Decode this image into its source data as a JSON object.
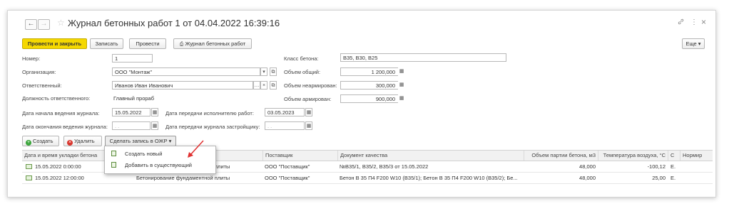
{
  "window": {
    "title": "Журнал бетонных работ 1 от 04.04.2022 16:39:16",
    "back_glyph": "←",
    "forward_glyph": "→",
    "link_glyph": "🔗",
    "menu_glyph": "⋮",
    "close_glyph": "×"
  },
  "toolbar": {
    "post_close": "Провести и закрыть",
    "save": "Записать",
    "post": "Провести",
    "journal": "Журнал бетонных работ",
    "more": "Еще ▾"
  },
  "form": {
    "number_label": "Номер:",
    "number_value": "1",
    "org_label": "Организация:",
    "org_value": "ООО \"Монтаж\"",
    "resp_label": "Ответственный:",
    "resp_value": "Иванов Иван Иванович",
    "position_label": "Должность ответственного:",
    "position_value": "Главный прораб",
    "start_label": "Дата начала ведения журнала:",
    "start_value": "15.05.2022",
    "end_label": "Дата окончания ведения журнала:",
    "end_value": ". .",
    "exec_label": "Дата передачи исполнителю работ:",
    "exec_value": "03.05.2023",
    "dev_label": "Дата передачи журнала застройщику:",
    "dev_value": ". .",
    "class_label": "Класс бетона:",
    "class_value": "В35, В30, В25",
    "vol_total_label": "Объем общий:",
    "vol_total_value": "1 200,000",
    "vol_unreinf_label": "Объем неармирован:",
    "vol_unreinf_value": "300,000",
    "vol_reinf_label": "Объем армирован:",
    "vol_reinf_value": "900,000"
  },
  "table_toolbar": {
    "create": "Создать",
    "delete": "Удалить",
    "make_record": "Сделать запись в ОЖР"
  },
  "dropdown": {
    "items": [
      "Создать новый",
      "Добавить в существующий"
    ]
  },
  "table": {
    "headers": [
      "Дата и время укладки бетона",
      "Поставщик",
      "Документ качества",
      "Объем партии бетона, м3",
      "Температура воздуха, °С",
      "С",
      "Нормир"
    ],
    "rows": [
      {
        "datetime": "15.05.2022 0:00:00",
        "work": "плиты",
        "supplier": "ООО \"Поставщик\"",
        "doc": "№В35/1, В35/2, В35/3 от 15.05.2022",
        "volume": "48,000",
        "temp": "-100,12",
        "c": "Е."
      },
      {
        "datetime": "15.05.2022 12:00:00",
        "work": "Бетонирование фундаментной плиты",
        "supplier": "ООО \"Поставщик\"",
        "doc": "Бетон В 35 П4 F200 W10 (В35/1); Бетон В 35 П4 F200 W10 (В35/2); Бе...",
        "volume": "48,000",
        "temp": "25,00",
        "c": "Е."
      }
    ]
  },
  "colors": {
    "primary_button": "#f5d800",
    "arrow": "#e03030"
  }
}
